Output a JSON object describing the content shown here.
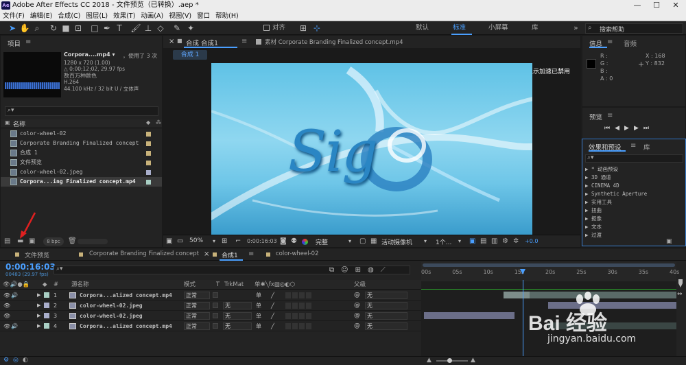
{
  "window": {
    "title": "Adobe After Effects CC 2018 - 文件预览（已转换）.aep *",
    "logo": "Ae",
    "minimize": "—",
    "maximize": "☐",
    "close": "✕"
  },
  "menu": [
    "文件(F)",
    "编辑(E)",
    "合成(C)",
    "图层(L)",
    "效果(T)",
    "动画(A)",
    "视图(V)",
    "窗口",
    "帮助(H)"
  ],
  "toolbar": {
    "align_label": "对齐",
    "workspaces": [
      "默认",
      "标准",
      "小屏幕",
      "库"
    ],
    "active_workspace": "标准",
    "search_placeholder": "搜索帮助",
    "more": "»"
  },
  "project": {
    "title": "项目",
    "selected": {
      "name": "Corpora....mp4 ▾",
      "usage": "，使用了 3 次",
      "res": "1280 x 720 (1.00)",
      "dur": "△ 0;00;12;02, 29.97 fps",
      "colors": "数百万种颜色",
      "codec": "H.264",
      "audio": "44.100 kHz / 32 bit U / 立体声"
    },
    "search_icon": "⌕▾",
    "col_name": "名称",
    "items": [
      {
        "name": "color-wheel-02",
        "color": "#c8b27a"
      },
      {
        "name": "Corporate Branding  Finalized concept",
        "color": "#c8b27a"
      },
      {
        "name": "合成 1",
        "color": "#c8b27a"
      },
      {
        "name": "文件预览",
        "color": "#c8b27a"
      },
      {
        "name": "color-wheel-02.jpeg",
        "color": "#a9aecb"
      },
      {
        "name": "Corpora...ing  Finalized concept.mp4",
        "color": "#a9cfc4"
      }
    ],
    "bpc": "8 bpc"
  },
  "comp": {
    "tab_label": "合成 合成1",
    "footage_tab": "素材 Corporate Branding  Finalized concept.mp4",
    "sub_tab": "合成 1",
    "accel_msg": "显示加速已禁用",
    "preview_text": "Sig",
    "zoom": "50%",
    "timecode": "0:00:16:03",
    "quality": "完整",
    "camera": "活动摄像机",
    "views": "1个...",
    "exposure": "+0.0"
  },
  "info": {
    "title": "信息",
    "audio_tab": "音频",
    "r": "R :",
    "g": "G :",
    "b": "B :",
    "a": "A : 0",
    "x": "X : 168",
    "y": "Y : 832"
  },
  "preview": {
    "title": "预览"
  },
  "effects": {
    "title": "效果和预设",
    "lib": "库",
    "search": "⌕▾",
    "items": [
      "▶ * 动画预设",
      "▶ 3D 通道",
      "▶ CINEMA 4D",
      "▶ Synthetic Aperture",
      "▶ 实用工具",
      "▶ 扭曲",
      "▶ 抠像",
      "▶ 文本",
      "▶ 过渡"
    ]
  },
  "timeline": {
    "tabs": [
      "文件预览",
      "Corporate Branding  Finalized concept",
      "合成1",
      "color-wheel-02"
    ],
    "tab_colors": [
      "#c8b27a",
      "#c8b27a",
      "#c8b27a",
      "#c8b27a"
    ],
    "active_tab": "合成1",
    "timecode": "0:00:16:03",
    "frames": "00483 (29.97 fps)",
    "search": "⌕▾",
    "cols": {
      "num": "#",
      "name": "源名称",
      "mode": "模式",
      "t": "T",
      "trkmat": "TrkMat",
      "parent": "父级"
    },
    "ruler": [
      "00s",
      "05s",
      "10s",
      "15s",
      "20s",
      "25s",
      "30s",
      "35s",
      "40s"
    ],
    "layers": [
      {
        "n": "1",
        "name": "Corpora...alized concept.mp4",
        "mode": "正常",
        "trk": "",
        "parent": "无",
        "label": "#a9cfc4"
      },
      {
        "n": "2",
        "name": "color-wheel-02.jpeg",
        "mode": "正常",
        "trk": "无",
        "parent": "无",
        "label": "#a9aecb"
      },
      {
        "n": "3",
        "name": "color-wheel-02.jpeg",
        "mode": "正常",
        "trk": "无",
        "parent": "无",
        "label": "#a9aecb"
      },
      {
        "n": "4",
        "name": "Corpora...alized concept.mp4",
        "mode": "正常",
        "trk": "无",
        "parent": "无",
        "label": "#a9cfc4"
      }
    ]
  },
  "watermark": {
    "brand": "Bai 经验",
    "url": "jingyan.baidu.com"
  }
}
